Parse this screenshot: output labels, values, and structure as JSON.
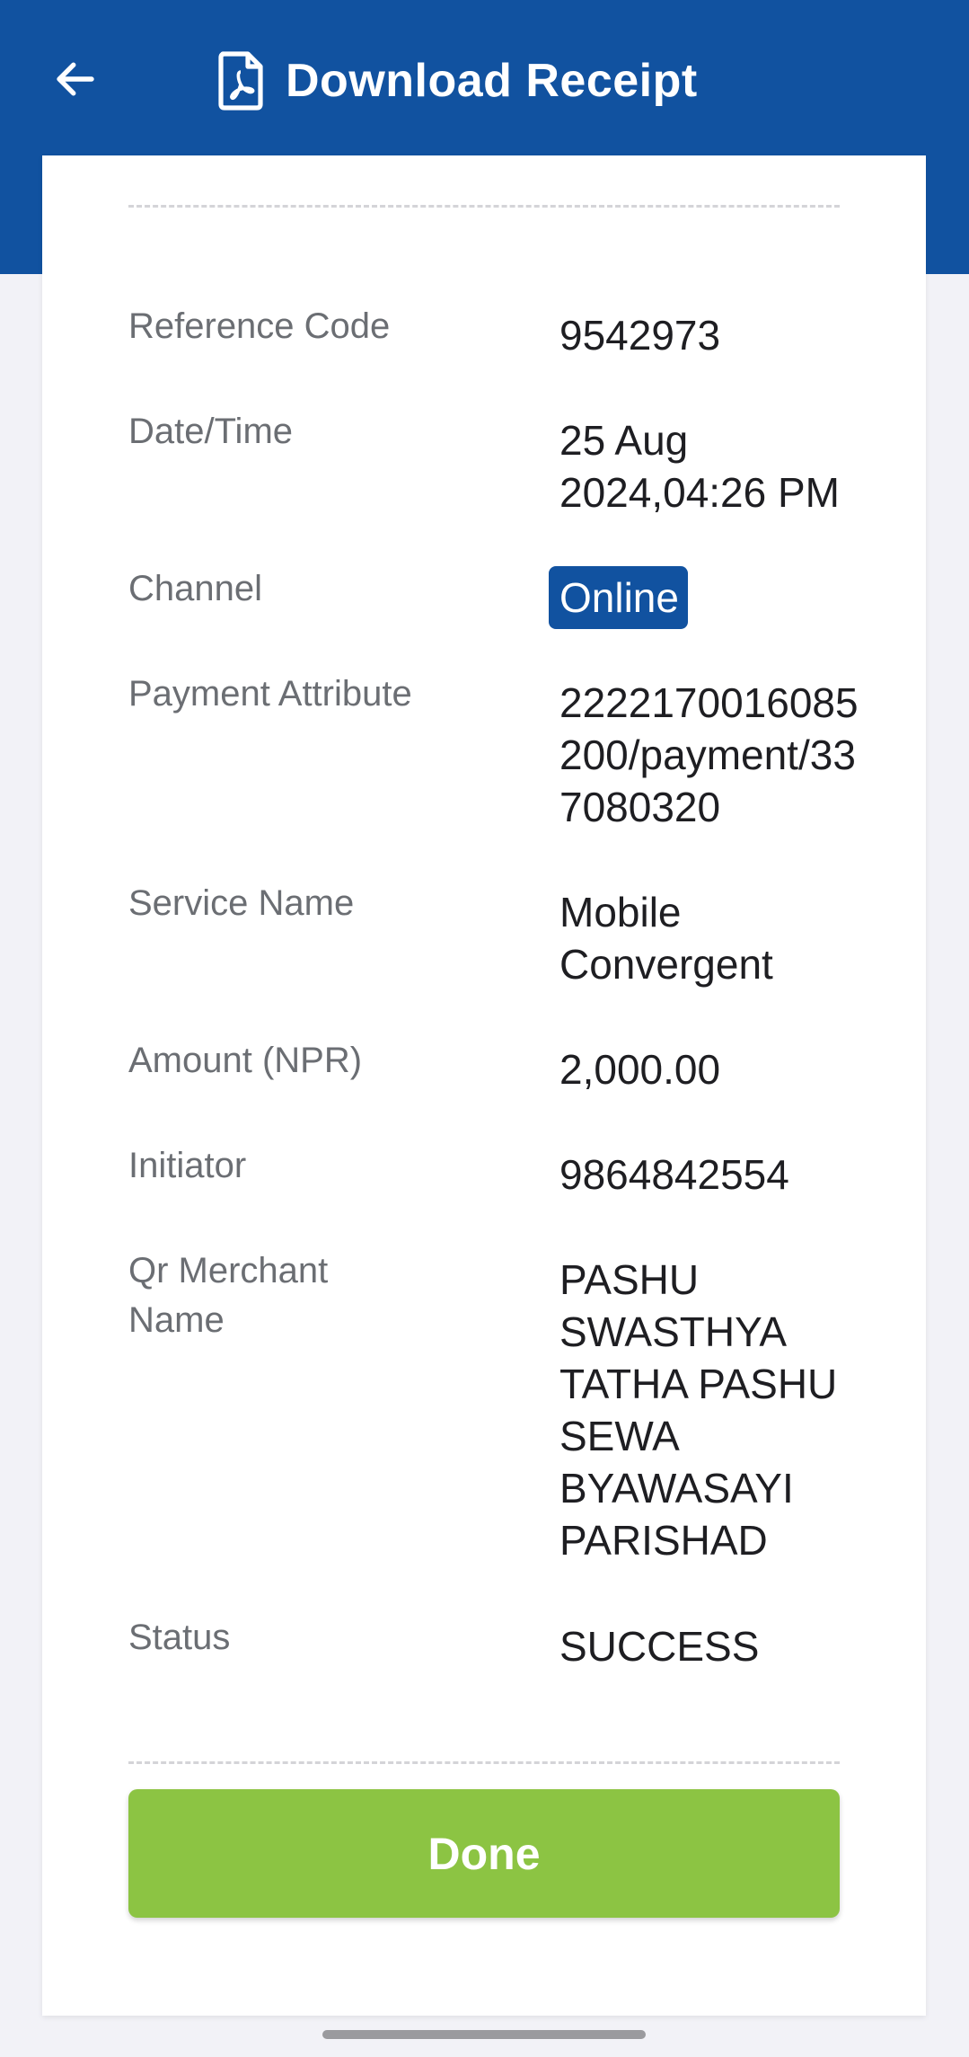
{
  "header": {
    "title": "Download Receipt",
    "back_icon": "arrow-left-icon",
    "title_icon": "pdf-file-icon",
    "color": "#1152a0"
  },
  "receipt": {
    "rows": [
      {
        "label": "Reference Code",
        "value": "9542973"
      },
      {
        "label": "Date/Time",
        "value": "25 Aug 2024,04:26 PM"
      },
      {
        "label": "Channel",
        "value": "Online"
      },
      {
        "label": "Payment Attribute",
        "value": "2222170016085200/payment/337080320"
      },
      {
        "label": "Service Name",
        "value": "Mobile Convergent"
      },
      {
        "label": "Amount (NPR)",
        "value": "2,000.00"
      },
      {
        "label": "Initiator",
        "value": "9864842554"
      },
      {
        "label": "Qr Merchant Name",
        "value": "PASHU SWASTHYA TATHA PASHU SEWA BYAWASAYI PARISHAD"
      },
      {
        "label": "Status",
        "value": "SUCCESS"
      }
    ]
  },
  "actions": {
    "done_label": "Done",
    "done_color": "#8cc443"
  }
}
